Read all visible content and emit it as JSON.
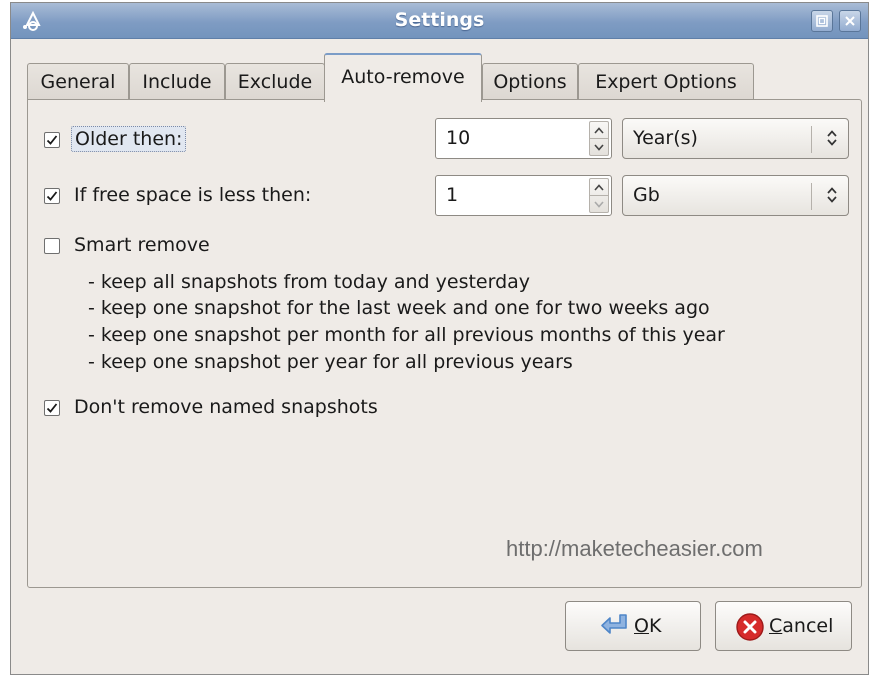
{
  "window": {
    "title": "Settings",
    "icons": {
      "app": "settings-app-icon",
      "maximize": "maximize-icon",
      "close": "close-icon"
    }
  },
  "tabs": [
    {
      "label": "General",
      "active": false
    },
    {
      "label": "Include",
      "active": false
    },
    {
      "label": "Exclude",
      "active": false
    },
    {
      "label": "Auto-remove",
      "active": true
    },
    {
      "label": "Options",
      "active": false
    },
    {
      "label": "Expert Options",
      "active": false
    }
  ],
  "auto_remove": {
    "older_than": {
      "checked": true,
      "label": "Older then:",
      "value": "10",
      "unit": "Year(s)"
    },
    "free_space": {
      "checked": true,
      "label": "If free space is less then:",
      "value": "1",
      "unit": "Gb"
    },
    "smart_remove": {
      "checked": false,
      "label": "Smart remove",
      "rules": [
        "- keep all snapshots from today and yesterday",
        "- keep one snapshot for the last week and one for two weeks ago",
        "- keep one snapshot per month for all previous months of this year",
        "- keep one snapshot per year for all previous years"
      ]
    },
    "keep_named": {
      "checked": true,
      "label": "Don't remove named snapshots"
    }
  },
  "watermark": "http://maketecheasier.com",
  "buttons": {
    "ok": {
      "mnemonic": "O",
      "rest": "K",
      "icon": "ok-arrow-icon"
    },
    "cancel": {
      "mnemonic": "C",
      "rest": "ancel",
      "icon": "cancel-x-icon"
    }
  },
  "colors": {
    "titlebar": "#7f9cc3",
    "window_bg": "#efebe7",
    "active_tab_accent": "#7b9cc7",
    "cancel_icon": "#d62b2b",
    "ok_icon": "#4f86c8"
  }
}
